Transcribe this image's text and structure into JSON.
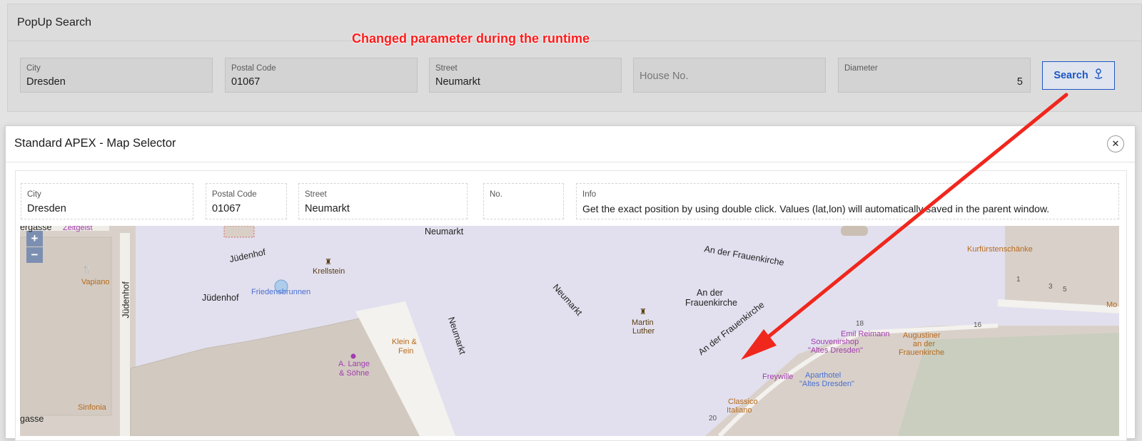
{
  "region": {
    "title": "PopUp Search"
  },
  "annotation": "Changed parameter during the runtime",
  "search_fields": {
    "city": {
      "label": "City",
      "value": "Dresden"
    },
    "postal": {
      "label": "Postal Code",
      "value": "01067"
    },
    "street": {
      "label": "Street",
      "value": "Neumarkt"
    },
    "house": {
      "placeholder": "House No."
    },
    "diameter": {
      "label": "Diameter",
      "value": "5"
    }
  },
  "search_button": {
    "label": "Search",
    "icon": "map-pin-icon"
  },
  "dialog": {
    "title": "Standard APEX - Map Selector",
    "close_icon": "close-icon",
    "fields": {
      "city": {
        "label": "City",
        "value": "Dresden"
      },
      "postal": {
        "label": "Postal Code",
        "value": "01067"
      },
      "street": {
        "label": "Street",
        "value": "Neumarkt"
      },
      "no": {
        "label": "No.",
        "value": ""
      },
      "info": {
        "label": "Info",
        "value": "Get the exact position by using double click. Values (lat,lon) will automatically saved in the parent window."
      }
    }
  },
  "map": {
    "zoom_in": "+",
    "zoom_out": "−",
    "labels": {
      "neumarkt_top": "Neumarkt",
      "neumarkt_diag": "Neumarkt",
      "neumarkt_vert": "Neumarkt",
      "an_der_frauenkirche_top": "An der Frauenkirche",
      "an_der_frauenkirche_mid": "An der",
      "an_der_frauenkirche_mid2": "Frauenkirche",
      "an_der_frauenkirche_diag": "An der Frauenkirche",
      "judenhof_1": "Jüdenhof",
      "judenhof_2": "Jüdenhof",
      "judenhof_vert": "Jüdenhof",
      "zeitgeist": "Zeitgeist",
      "fergasse": "ergasse",
      "gasse": "gasse",
      "vapiano": "Vapiano",
      "friedensbrunnen": "Friedensbrunnen",
      "krellstein": "Krellstein",
      "klein_fein_1": "Klein &",
      "klein_fein_2": "Fein",
      "a_lange_1": "A. Lange",
      "a_lange_2": "& Söhne",
      "sinfonia": "Sinfonia",
      "martin_1": "Martin",
      "martin_2": "Luther",
      "emil": "Emil Reimann",
      "souvenir_1": "Souvenirshop",
      "souvenir_2": "\"Altes Dresden\"",
      "augustiner_1": "Augustiner",
      "augustiner_2": "an der",
      "augustiner_3": "Frauenkirche",
      "aparthotel_1": "Aparthotel",
      "aparthotel_2": "\"Altes Dresden\"",
      "freywille": "Freywille",
      "classico_1": "Classico",
      "classico_2": "Italiano",
      "kurfuersten": "Kurfürstenschänke",
      "mo": "Mo",
      "num_18": "18",
      "num_16": "16",
      "num_1": "1",
      "num_3": "3",
      "num_5": "5",
      "num_20": "20"
    }
  },
  "colors": {
    "annotation": "#ff1a1a",
    "accent": "#1d56c2",
    "arrow": "#f0271d",
    "square": "#e2e0ee",
    "building": "#d9d1c9",
    "park": "#c9cebf"
  }
}
